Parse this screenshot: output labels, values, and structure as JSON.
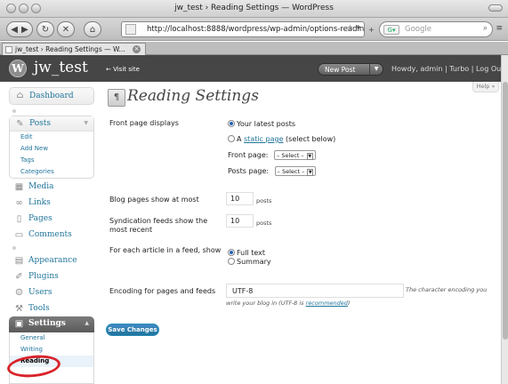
{
  "browser": {
    "window_title": "jw_test › Reading Settings — WordPress",
    "url": "http://localhost:8888/wordpress/wp-admin/options-readin",
    "search_placeholder": "Google",
    "tab_title": "jw_test › Reading Settings — W..."
  },
  "header": {
    "site_title": "jw_test",
    "visit_site": "← Visit site",
    "new_post": "New Post",
    "howdy": "Howdy, admin | Turbo | Log Out"
  },
  "sidebar": {
    "dashboard": "Dashboard",
    "posts": "Posts",
    "posts_sub": [
      "Edit",
      "Add New",
      "Tags",
      "Categories"
    ],
    "media": "Media",
    "links": "Links",
    "pages": "Pages",
    "comments": "Comments",
    "appearance": "Appearance",
    "plugins": "Plugins",
    "users": "Users",
    "tools": "Tools",
    "settings": "Settings",
    "settings_sub": [
      "General",
      "Writing",
      "Reading"
    ]
  },
  "main": {
    "help": "Help »",
    "title": "Reading Settings",
    "front_label": "Front page displays",
    "opt_latest": "Your latest posts",
    "opt_static_prefix": "A ",
    "opt_static_link": "static page",
    "opt_static_suffix": " (select below)",
    "front_page": "Front page:",
    "posts_page": "Posts page:",
    "select_value": "– Select –",
    "blog_label": "Blog pages show at most",
    "blog_value": "10",
    "blog_unit": "posts",
    "synd_label": "Syndication feeds show the most recent",
    "synd_value": "10",
    "synd_unit": "posts",
    "article_label": "For each article in a feed, show",
    "opt_full": "Full text",
    "opt_summary": "Summary",
    "enc_label": "Encoding for pages and feeds",
    "enc_value": "UTF-8",
    "enc_desc": "The character encoding you",
    "enc_help_prefix": "write your blog in (UTF-8 is ",
    "enc_help_link": "recommended",
    "enc_help_suffix": ")",
    "save": "Save Changes"
  }
}
